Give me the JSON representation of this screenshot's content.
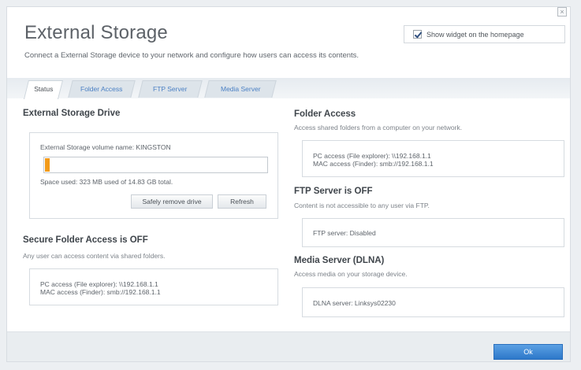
{
  "header": {
    "title": "External Storage",
    "subtitle": "Connect a External Storage device to your network and configure how users can access its contents.",
    "close_label": "×",
    "widget_label": "Show widget on the homepage"
  },
  "tabs": [
    {
      "label": "Status"
    },
    {
      "label": "Folder Access"
    },
    {
      "label": "FTP Server"
    },
    {
      "label": "Media Server"
    }
  ],
  "drive": {
    "title": "External Storage Drive",
    "volume_name": "External Storage volume name: KINGSTON",
    "usage_text": "Space used: 323 MB used of 14.83 GB total.",
    "usage_fraction": 0.0213,
    "usage_color": "#f29a1a",
    "safely_remove_label": "Safely remove drive",
    "refresh_label": "Refresh"
  },
  "secure_access": {
    "title": "Secure Folder Access is OFF",
    "subtitle": "Any user can access content via shared folders.",
    "pc_access": "PC access (File explorer): \\\\192.168.1.1",
    "mac_access": "MAC access (Finder): smb://192.168.1.1"
  },
  "folder_access": {
    "title": "Folder Access",
    "subtitle": "Access shared folders from a computer on your network.",
    "pc_access": "PC access (File explorer): \\\\192.168.1.1",
    "mac_access": "MAC access (Finder): smb://192.168.1.1"
  },
  "ftp": {
    "title": "FTP Server is OFF",
    "subtitle": "Content is not accessible to any user via FTP.",
    "status": "FTP server: Disabled"
  },
  "media": {
    "title": "Media Server (DLNA)",
    "subtitle": "Access media on your storage device.",
    "status": "DLNA server: Linksys02230"
  },
  "footer": {
    "ok_label": "Ok"
  },
  "colors": {
    "accent": "#2d78c9",
    "link": "#4b80c4"
  }
}
